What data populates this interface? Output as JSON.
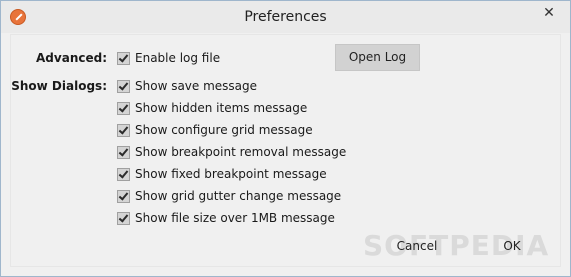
{
  "window": {
    "title": "Preferences",
    "close_glyph": "✕",
    "app_icon": "app-rocket-icon"
  },
  "advanced": {
    "label": "Advanced:",
    "options": [
      {
        "label": "Enable log file",
        "checked": true
      }
    ],
    "open_log_label": "Open Log"
  },
  "dialogs": {
    "label": "Show Dialogs:",
    "options": [
      {
        "label": "Show save message",
        "checked": true
      },
      {
        "label": "Show hidden items message",
        "checked": true
      },
      {
        "label": "Show configure grid message",
        "checked": true
      },
      {
        "label": "Show breakpoint removal message",
        "checked": true
      },
      {
        "label": "Show fixed breakpoint message",
        "checked": true
      },
      {
        "label": "Show grid gutter change message",
        "checked": true
      },
      {
        "label": "Show file size over 1MB message",
        "checked": true
      }
    ]
  },
  "footer": {
    "cancel_label": "Cancel",
    "ok_label": "OK"
  },
  "watermark": "SOFTPEDIA"
}
